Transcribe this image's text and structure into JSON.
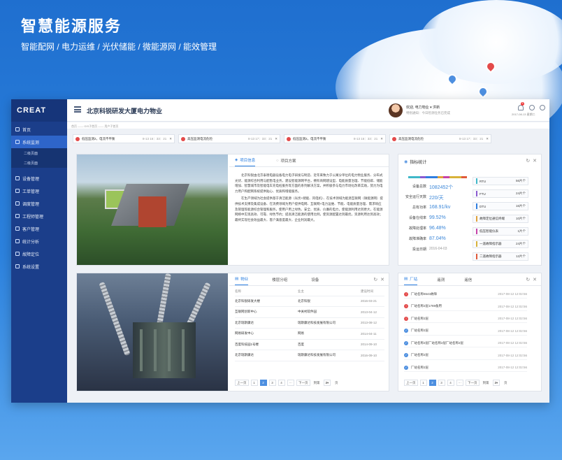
{
  "hero": {
    "title": "智慧能源服务",
    "subtitle": "智能配网 / 电力运维 / 光伏储能 / 微能源网 / 能效管理"
  },
  "app": {
    "logo": "CREAT",
    "company": "北京科锐研发大厦电力物业",
    "user": {
      "welcome": "欢迎, 电力物业 ▾ 洪新",
      "sub": "特别通知：今日检测任务已完成"
    },
    "datetime": "2017-08-13  星期二",
    "badge": "5",
    "breadcrumb": "首页 ——  GIS子首页 ——  用户子首页",
    "nav": [
      {
        "label": "首页",
        "active": false
      },
      {
        "label": "系统监测",
        "active": true,
        "subs": [
          "二级页面",
          "二级页面"
        ]
      },
      {
        "label": "设备管理"
      },
      {
        "label": "工单管理"
      },
      {
        "label": "调度管理"
      },
      {
        "label": "工程师管理"
      },
      {
        "label": "客户管理"
      },
      {
        "label": "统计分析"
      },
      {
        "label": "故障定位"
      },
      {
        "label": "系统设置"
      }
    ],
    "alarms": [
      {
        "text": "低压监测2，电流不平衡",
        "time": "8-13  16：33：21"
      },
      {
        "text": "高压监测电流危险",
        "time": "8-13  17：33：21"
      },
      {
        "text": "低压监测2，电流不平衡",
        "time": "8-13  16：33：21"
      },
      {
        "text": "高压监测电流危险",
        "time": "8-13  17：33：21"
      }
    ],
    "info": {
      "tabs": [
        "项目信息",
        "项目方案"
      ],
      "p1": "北京科锐由北京泰德电器设备电力电子研发与制造、近年来致力于公寓分单位的电力物业服务、分布式光伏、能源综合利用与配售电业务，建设智能源网平台，拥有商网建设型、电能质量治理、节能低碳、储能增加、智慧城市及智能电车充电桩服务等方面的系列解决方案，并积极参与电力市场化改革实践，努力为电力用户和配网系统提供贴心、优质和增能服务。",
      "p2": "在生产领域为社会提供基于清洁能源（光伏+储能、风电机）、在技术领域为能源互联网（微能源网）提供技术支撑及集成设备、在消费领域为用户提供电网、互联网+电力运维、节能、电能质量治理、需求响应及管理等能源综合管理和服务，使用户用上绿色、安全、优质、价廉的电力，使能源利用达到更大，在能源网络中实现高效、可靠、绿色节约；提高清洁能源的使用比例，使资源配置达到最优，资源利用达到高效；最终实现社会效益最大、客户满意度最大、企业利润最大。"
    },
    "stats": {
      "title": "指标统计",
      "metrics": [
        {
          "label": "设备总数",
          "value": "1082452个"
        },
        {
          "label": "安全运行天数",
          "value": "220/天"
        },
        {
          "label": "总有功率",
          "value": "168.91/kv"
        },
        {
          "label": "设备在线率",
          "value": "99.52%"
        },
        {
          "label": "故障处理率",
          "value": "96.48%"
        },
        {
          "label": "故障准确率",
          "value": "87.04%"
        },
        {
          "label": "投运日期",
          "value": "2016-04-03"
        }
      ],
      "boxes": [
        {
          "label": "RTU",
          "value": "56片个",
          "color": "#3fb8c9"
        },
        {
          "label": "FTU",
          "value": "24片个",
          "color": "#8a5ad1"
        },
        {
          "label": "DTU",
          "value": "16片个",
          "color": "#2f7ee0"
        },
        {
          "label": "故障定位通信终端",
          "value": "10片个",
          "color": "#e0a23a"
        },
        {
          "label": "低压智能仪表",
          "value": "1片个",
          "color": "#c742a8"
        },
        {
          "label": "一遥故障指示器",
          "value": "24片个",
          "color": "#d8b23a"
        },
        {
          "label": "二遥故障指示器",
          "value": "12片个",
          "color": "#e05a3a"
        }
      ]
    },
    "property": {
      "tabs": [
        "物业",
        "楼层分组",
        "设备"
      ],
      "headers": [
        "名称",
        "业主",
        "建设时间"
      ],
      "rows": [
        [
          "北京科锐研发大楼",
          "北京科锐",
          "2016-03-21"
        ],
        [
          "互联网创新中心",
          "中关村软件园",
          "2013-04-12"
        ],
        [
          "北京瑞斯康达",
          "瑞斯康达科技发展有限公司",
          "2013-08-12"
        ],
        [
          "网易研发中心",
          "网易",
          "2014-04-11"
        ],
        [
          "百度科技园1号楼",
          "百度",
          "2014-09-10"
        ],
        [
          "北京瑞斯康达",
          "瑞斯康达科技发展有限公司",
          "2016-09-10"
        ]
      ]
    },
    "pager1": {
      "prev": "上一页",
      "pages": [
        "1",
        "2",
        "3",
        "4",
        "···"
      ],
      "next": "下一页",
      "goto": "到第",
      "page": "3",
      "unit": "页"
    },
    "msgs": {
      "tabs": [
        "厂站",
        "遥测",
        "遥信"
      ],
      "rows": [
        {
          "text": "厂站名称6543故障",
          "date": "2017-08-12  12:02:56",
          "type": "alert"
        },
        {
          "text": "厂站名称2层1769备用",
          "date": "2017-08-12  12:02:56",
          "type": "alert"
        },
        {
          "text": "厂站名称2层",
          "date": "2017-08-12  12:02:56",
          "type": "alert"
        },
        {
          "text": "厂站名称2层",
          "date": "2017-08-12  12:02:56",
          "type": "ok"
        },
        {
          "text": "厂站名称2层厂站名称2层厂站名称2层",
          "date": "2017-08-12  12:02:56",
          "type": "ok"
        },
        {
          "text": "厂站名称2层",
          "date": "2017-08-12  12:02:56",
          "type": "ok"
        },
        {
          "text": "厂站名称2层",
          "date": "2017-08-12  12:02:56",
          "type": "ok"
        }
      ]
    }
  }
}
